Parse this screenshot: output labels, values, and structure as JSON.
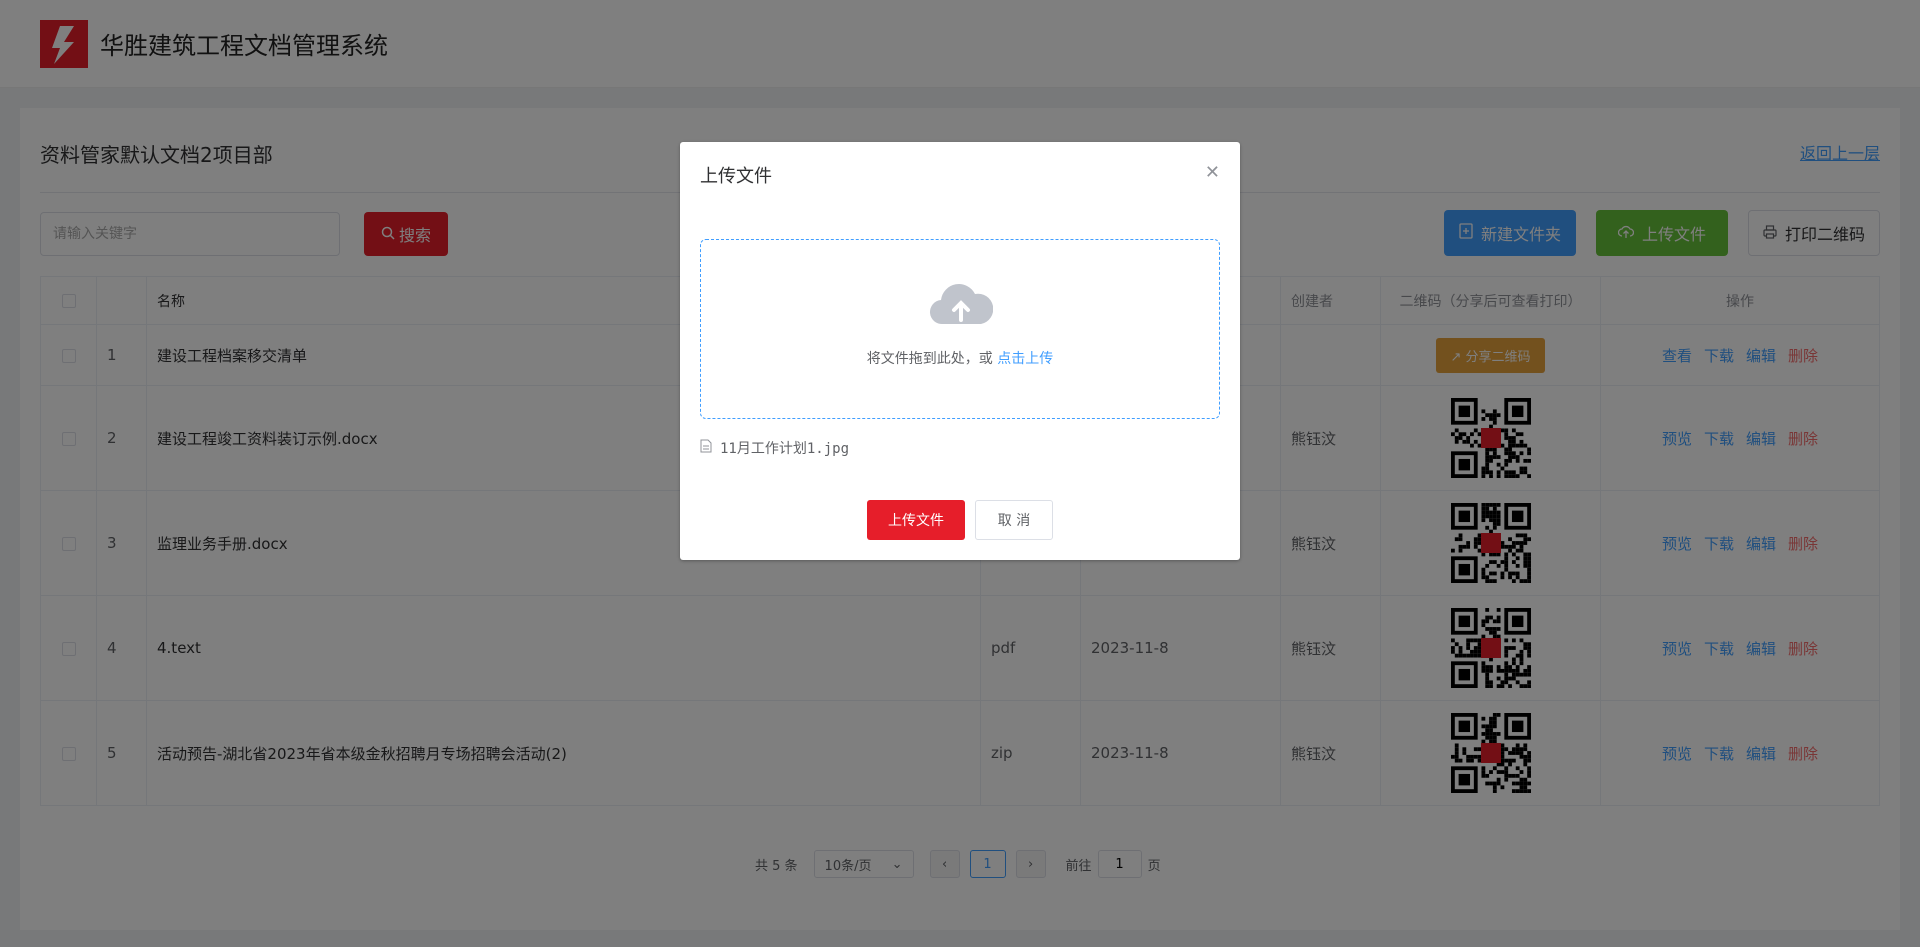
{
  "app": {
    "title": "华胜建筑工程文档管理系统",
    "brand_color": "#e61e2a"
  },
  "page": {
    "title": "资料管家默认文档2项目部",
    "back_label": "返回上一层"
  },
  "toolbar": {
    "search_placeholder": "请输入关键字",
    "search_label": "搜索",
    "new_folder_label": "新建文件夹",
    "upload_label": "上传文件",
    "print_qr_label": "打印二维码"
  },
  "table": {
    "headers": {
      "name": "名称",
      "type": "",
      "date": "",
      "creator": "创建者",
      "qr": "二维码（分享后可查看打印）",
      "ops": "操作"
    },
    "rows": [
      {
        "index": "1",
        "name": "建设工程档案移交清单",
        "type": "",
        "date": "",
        "creator": "",
        "share_label": "分享二维码",
        "ops": [
          "查看",
          "下载",
          "编辑",
          "删除"
        ]
      },
      {
        "index": "2",
        "name": "建设工程竣工资料装订示例.docx",
        "type": "",
        "date": "",
        "creator": "熊钰汶",
        "ops": [
          "预览",
          "下载",
          "编辑",
          "删除"
        ]
      },
      {
        "index": "3",
        "name": "监理业务手册.docx",
        "type": "",
        "date": "",
        "creator": "熊钰汶",
        "ops": [
          "预览",
          "下载",
          "编辑",
          "删除"
        ]
      },
      {
        "index": "4",
        "name": "4.text",
        "type": "pdf",
        "date": "2023-11-8",
        "creator": "熊钰汶",
        "ops": [
          "预览",
          "下载",
          "编辑",
          "删除"
        ]
      },
      {
        "index": "5",
        "name": "活动预告-湖北省2023年省本级金秋招聘月专场招聘会活动(2)",
        "type": "zip",
        "date": "2023-11-8",
        "creator": "熊钰汶",
        "ops": [
          "预览",
          "下载",
          "编辑",
          "删除"
        ]
      }
    ]
  },
  "pagination": {
    "total_label": "共 5 条",
    "page_size": "10条/页",
    "current_page": "1",
    "goto_label": "前往",
    "goto_value": "1",
    "page_suffix": "页"
  },
  "dialog": {
    "title": "上传文件",
    "drop_text": "将文件拖到此处，或",
    "drop_link": "点击上传",
    "file_name": "11月工作计划1.jpg",
    "ok_label": "上传文件",
    "cancel_label": "取 消"
  }
}
